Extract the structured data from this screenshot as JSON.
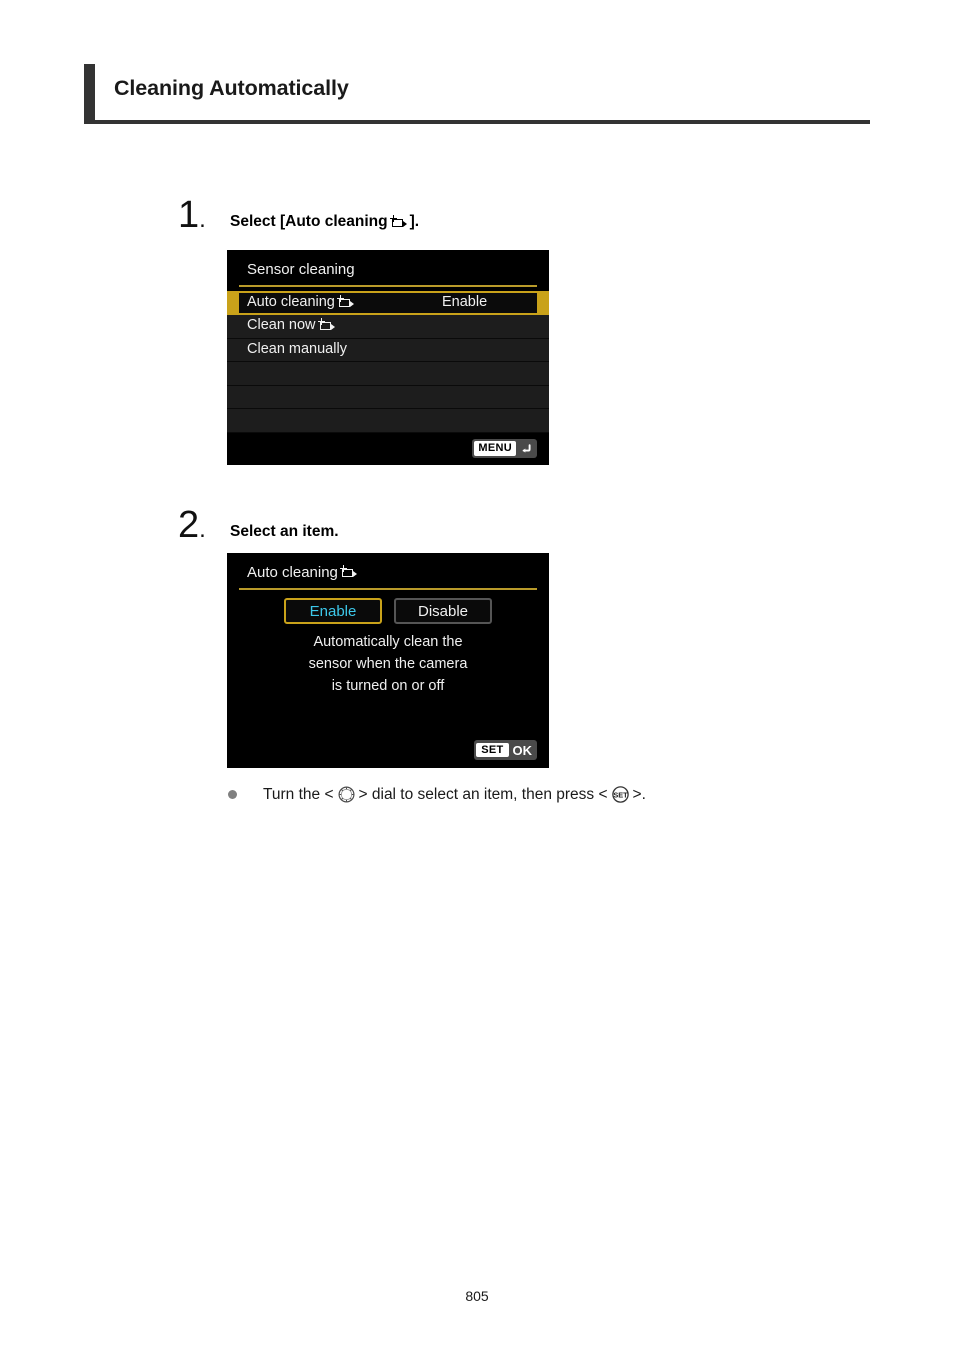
{
  "page": {
    "title": "Cleaning Automatically",
    "number": "805",
    "accent_color": "#333333"
  },
  "steps": [
    {
      "number": "1",
      "dot": ".",
      "text_before": "Select [Auto cleaning",
      "icon": "sensor-cleaning-icon",
      "text_after": "].",
      "screen": {
        "name": "sensor-cleaning-menu",
        "title": "Sensor cleaning",
        "title_rule_color": "#b99b2a",
        "highlight_color": "#c9a21a",
        "rows": [
          {
            "label": "Auto cleaning",
            "icon": "sensor-cleaning-icon",
            "value": "Enable",
            "selected": true
          },
          {
            "label": "Clean now",
            "icon": "sensor-cleaning-icon",
            "value": "",
            "selected": false
          },
          {
            "label": "Clean manually",
            "icon": "",
            "value": "",
            "selected": false
          },
          {
            "label": "",
            "icon": "",
            "value": "",
            "selected": false
          },
          {
            "label": "",
            "icon": "",
            "value": "",
            "selected": false
          },
          {
            "label": "",
            "icon": "",
            "value": "",
            "selected": false
          }
        ],
        "footer_button": {
          "name": "menu-back-button",
          "chip": "MENU",
          "icon": "back-arrow-icon"
        }
      }
    },
    {
      "number": "2",
      "dot": ".",
      "text_before": "Select an item.",
      "icon": "",
      "text_after": "",
      "screen": {
        "name": "auto-cleaning-option-screen",
        "title": "Auto cleaning",
        "title_icon": "sensor-cleaning-icon",
        "title_rule_color": "#b99b2a",
        "options": [
          {
            "label": "Enable",
            "selected": true,
            "text_color": "#3dc8ea",
            "border_color": "#c9a21a"
          },
          {
            "label": "Disable",
            "selected": false,
            "text_color": "#f0f0f0",
            "border_color": "#555555"
          }
        ],
        "description_lines": [
          "Automatically clean the",
          "sensor when the camera",
          "is turned on or off"
        ],
        "footer_button": {
          "name": "set-ok-button",
          "chip": "SET",
          "label": "OK"
        }
      }
    }
  ],
  "note": {
    "bullet": "•",
    "part1": "Turn the <",
    "dial_icon": "quick-control-dial-icon",
    "part2": "> dial to select an item, then press <",
    "set_icon": "set-button-icon",
    "part3": ">."
  }
}
